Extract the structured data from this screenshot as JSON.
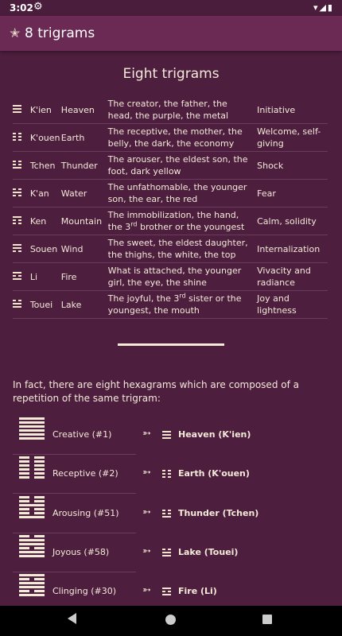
{
  "status_bar": {
    "time": "3:02",
    "right_icons": "▾◢▮"
  },
  "app_bar": {
    "title": "8 trigrams"
  },
  "heading": "Eight trigrams",
  "trigrams": [
    {
      "lines": [
        1,
        1,
        1
      ],
      "name": "K'ien",
      "nature": "Heaven",
      "desc": "The creator, the father, the head, the purple, the metal",
      "attr": "Initiative"
    },
    {
      "lines": [
        0,
        0,
        0
      ],
      "name": "K'ouen",
      "nature": "Earth",
      "desc": "The receptive, the mother, the belly, the dark, the economy",
      "attr": "Welcome, self-giving"
    },
    {
      "lines": [
        0,
        0,
        1
      ],
      "name": "Tchen",
      "nature": "Thunder",
      "desc": "The arouser, the eldest son, the foot, dark yellow",
      "attr": "Shock"
    },
    {
      "lines": [
        0,
        1,
        0
      ],
      "name": "K'an",
      "nature": "Water",
      "desc": "The unfathomable, the younger son, the ear, the red",
      "attr": "Fear"
    },
    {
      "lines": [
        1,
        0,
        0
      ],
      "name": "Ken",
      "nature": "Mountain",
      "desc_pre": "The immobilization, the hand, the 3",
      "desc_sup": "rd",
      "desc_post": " brother or the youngest",
      "attr": "Calm, solidity"
    },
    {
      "lines": [
        1,
        1,
        0
      ],
      "name": "Souen",
      "nature": "Wind",
      "desc": "The sweet, the eldest daughter, the thighs, the white, the top",
      "attr": "Internalization"
    },
    {
      "lines": [
        1,
        0,
        1
      ],
      "name": "Li",
      "nature": "Fire",
      "desc": "What is attached, the younger girl, the eye, the shine",
      "attr": "Vivacity and radiance"
    },
    {
      "lines": [
        0,
        1,
        1
      ],
      "name": "Touei",
      "nature": "Lake",
      "desc_pre": "The joyful, the 3",
      "desc_sup": "rd",
      "desc_post": " sister or the youngest, the mouth",
      "attr": "Joy and lightness"
    }
  ],
  "paragraph": "In fact, there are eight hexagrams which are composed of a repetition of the same trigram:",
  "hexagrams": [
    {
      "name": "Creative (#1)",
      "lines": [
        1,
        1,
        1,
        1,
        1,
        1
      ],
      "trigram_lines": [
        1,
        1,
        1
      ],
      "trigram": "Heaven (K'ien)"
    },
    {
      "name": "Receptive (#2)",
      "lines": [
        0,
        0,
        0,
        0,
        0,
        0
      ],
      "trigram_lines": [
        0,
        0,
        0
      ],
      "trigram": "Earth (K'ouen)"
    },
    {
      "name": "Arousing (#51)",
      "lines": [
        0,
        0,
        1,
        0,
        0,
        1
      ],
      "trigram_lines": [
        0,
        0,
        1
      ],
      "trigram": "Thunder (Tchen)"
    },
    {
      "name": "Joyous (#58)",
      "lines": [
        0,
        1,
        1,
        0,
        1,
        1
      ],
      "trigram_lines": [
        0,
        1,
        1
      ],
      "trigram": "Lake (Touei)"
    },
    {
      "name": "Clinging (#30)",
      "lines": [
        1,
        0,
        1,
        1,
        0,
        1
      ],
      "trigram_lines": [
        1,
        0,
        1
      ],
      "trigram": "Fire (Li)"
    }
  ],
  "arrow_glyph": "➳",
  "colors": {
    "background": "#4e1e3f",
    "app_bar": "#6a2a54",
    "text": "#f3ead8",
    "separator": "#6a3c5c"
  }
}
